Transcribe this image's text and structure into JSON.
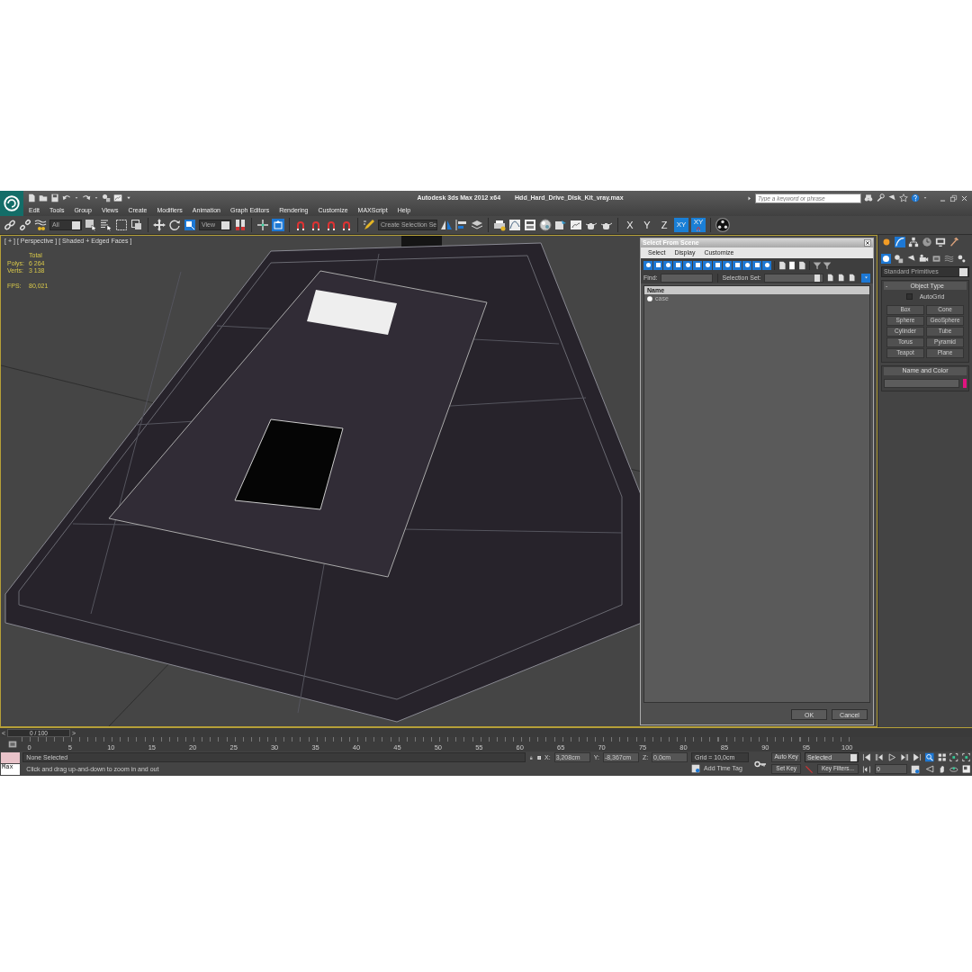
{
  "title_bar": {
    "title": "Autodesk 3ds Max  2012 x64",
    "file_name": "Hdd_Hard_Drive_Disk_Kit_vray.max",
    "search": {
      "placeholder": "Type a keyword or phrase"
    }
  },
  "menu": [
    "Edit",
    "Tools",
    "Group",
    "Views",
    "Create",
    "Modifiers",
    "Animation",
    "Graph Editors",
    "Rendering",
    "Customize",
    "MAXScript",
    "Help"
  ],
  "toolbar": {
    "selection_filter": "All",
    "reference_coordinate_system": "View",
    "named_selection_set": "Create Selection Se",
    "axis_constraints": [
      {
        "label": "X",
        "kind": "axis",
        "selected": false
      },
      {
        "label": "Y",
        "kind": "axis",
        "selected": false
      },
      {
        "label": "Z",
        "kind": "axis",
        "selected": false
      },
      {
        "label": "XY",
        "kind": "axis",
        "selected": true
      },
      {
        "label": "XY",
        "kind": "flyout",
        "selected": true
      }
    ]
  },
  "viewport": {
    "labels": [
      "[ + ]",
      "[ Perspective ]",
      "[ Shaded + Edged Faces ]"
    ],
    "stats_header": "Total",
    "stats": [
      {
        "label": "Polys:",
        "value": "6 264"
      },
      {
        "label": "Verts:",
        "value": "3 138"
      }
    ],
    "fps": {
      "label": "FPS:",
      "value": "80,021"
    }
  },
  "dialog": {
    "title": "Select From Scene",
    "menu": [
      "Select",
      "Display",
      "Customize"
    ],
    "find_label": "Find:",
    "selection_set_label": "Selection Set:",
    "column": "Name",
    "rows": [
      {
        "name": "case"
      }
    ],
    "buttons": [
      "OK",
      "Cancel"
    ]
  },
  "command_panel": {
    "category": "Standard Primitives",
    "object_type": {
      "title": "Object Type",
      "collapse": "-",
      "autogrid": {
        "label": "AutoGrid",
        "checked": false
      },
      "buttons": [
        "Box",
        "Cone",
        "Sphere",
        "GeoSphere",
        "Cylinder",
        "Tube",
        "Torus",
        "Pyramid",
        "Teapot",
        "Plane"
      ]
    },
    "name_and_color": {
      "title": "Name and Color",
      "color": "#e0137f"
    }
  },
  "timeline": {
    "previous": "<",
    "frame_counter": "0 / 100",
    "level": 0,
    "next": ">",
    "ticks": [
      "0",
      "5",
      "10",
      "15",
      "20",
      "25",
      "30",
      "35",
      "40",
      "45",
      "50",
      "55",
      "60",
      "65",
      "70",
      "75",
      "80",
      "85",
      "90",
      "95",
      "100"
    ]
  },
  "status": {
    "selection": "None Selected",
    "prompt": "Click and drag up-and-down to zoom in and out",
    "script_label": "Max",
    "coords": [
      {
        "label": "X:",
        "value": "3,208cm"
      },
      {
        "label": "Y:",
        "value": "-8,367cm"
      },
      {
        "label": "Z:",
        "value": "0,0cm"
      }
    ],
    "grid": "Grid = 10,0cm",
    "add_time_tag": "Add Time Tag",
    "auto_key": "Auto Key",
    "set_key": "Set Key",
    "key_mode": "Selected",
    "key_filters": "Key Filters...",
    "current_frame": "0"
  }
}
